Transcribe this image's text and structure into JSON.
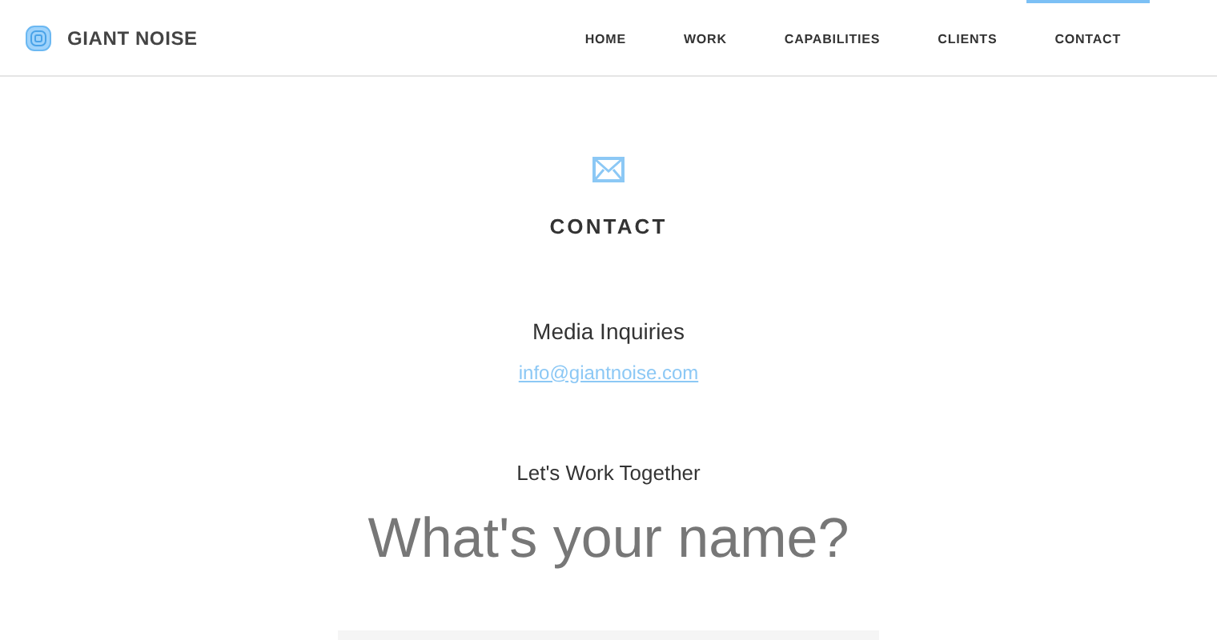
{
  "brand": "GIANT NOISE",
  "nav": [
    {
      "label": "HOME",
      "selected": false
    },
    {
      "label": "WORK",
      "selected": false
    },
    {
      "label": "CAPABILITIES",
      "selected": false
    },
    {
      "label": "CLIENTS",
      "selected": false
    },
    {
      "label": "CONTACT",
      "selected": true
    }
  ],
  "heading": "CONTACT",
  "media": {
    "title": "Media Inquiries",
    "email": "info@giantnoise.com"
  },
  "form": {
    "title": "Let's Work Together",
    "question": "What's your name?"
  }
}
